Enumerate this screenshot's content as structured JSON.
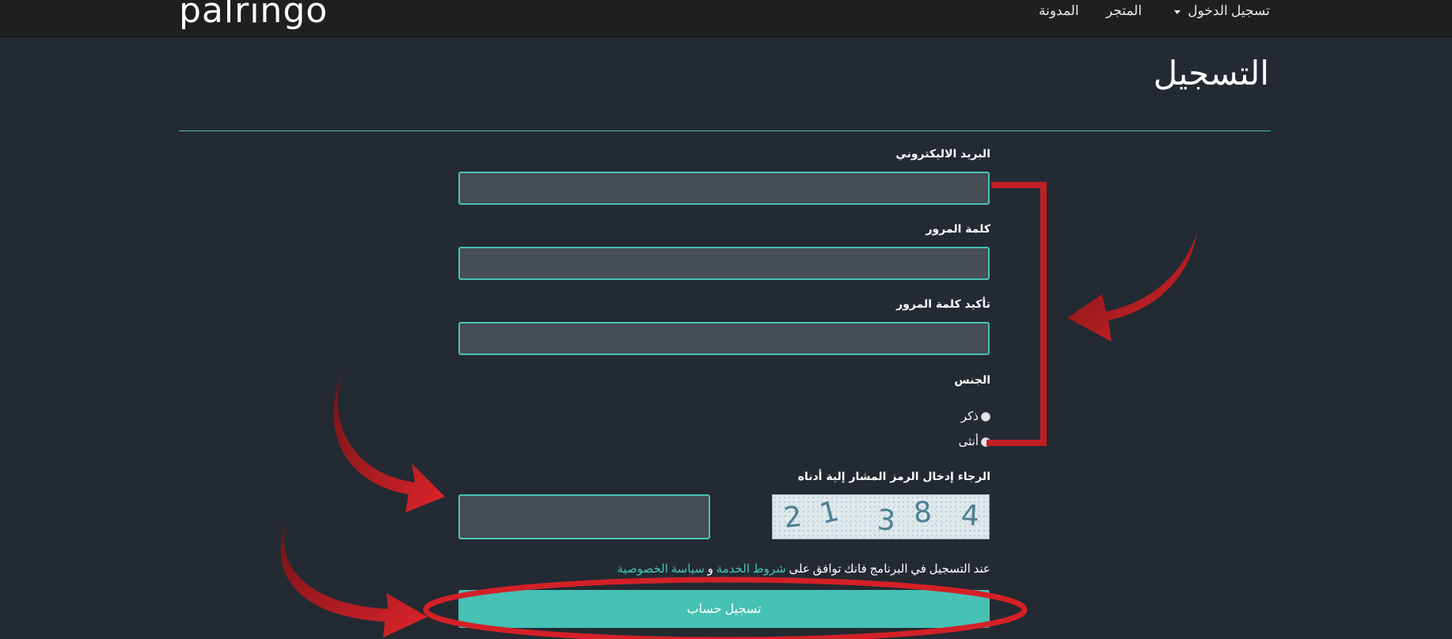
{
  "header": {
    "logo_text": "palringo",
    "nav": {
      "register_login": "تسجيل الدخول",
      "store": "المتجر",
      "blog": "المدونة"
    }
  },
  "page": {
    "title": "التسجيل"
  },
  "form": {
    "email_label": "البريد الاليكتروني",
    "email_value": "",
    "password_label": "كلمة المرور",
    "password_value": "",
    "confirm_password_label": "تأكيد كلمة المرور",
    "confirm_password_value": "",
    "gender_label": "الجنس",
    "gender_male": "ذكر",
    "gender_female": "أنثى",
    "captcha_label": "الرجاء إدخال الرمز المشار إلية أدناه",
    "captcha_value": "",
    "captcha_digits": [
      "2",
      "1",
      "3",
      "8",
      "4"
    ],
    "terms_prefix": "عند التسجيل في البرنامج فانك توافق على",
    "terms_link": "شروط الخدمة",
    "terms_and": "و",
    "privacy_link": "سياسة الخصوصية",
    "submit_label": "تسجيل حساب"
  },
  "colors": {
    "accent": "#46c1b4",
    "background": "#232a32",
    "topbar": "#1d1f21",
    "annotation": "#d42027"
  }
}
